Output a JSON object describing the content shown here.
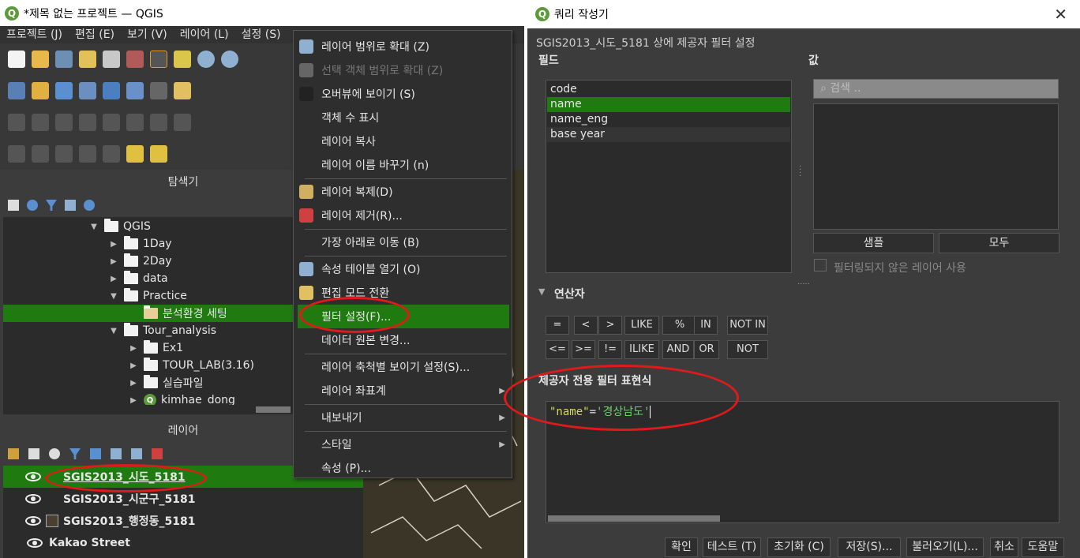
{
  "qgis": {
    "title": "*제목 없는 프로젝트 — QGIS",
    "menu": [
      "프로젝트 (J)",
      "편집 (E)",
      "보기 (V)",
      "레이어 (L)",
      "설정 (S)"
    ],
    "browser_title": "탐색기",
    "browser_items": [
      {
        "label": "QGIS",
        "depth": 0,
        "arrow": "▼",
        "icon": "folder-icon"
      },
      {
        "label": "1Day",
        "depth": 1,
        "arrow": "▶",
        "icon": "folder-icon"
      },
      {
        "label": "2Day",
        "depth": 1,
        "arrow": "▶",
        "icon": "folder-icon"
      },
      {
        "label": "data",
        "depth": 1,
        "arrow": "▶",
        "icon": "folder-icon"
      },
      {
        "label": "Practice",
        "depth": 1,
        "arrow": "▼",
        "icon": "folder-icon"
      },
      {
        "label": "분석환경 세팅",
        "depth": 2,
        "arrow": "",
        "icon": "folder-icon"
      },
      {
        "label": "Tour_analysis",
        "depth": 1,
        "arrow": "▼",
        "icon": "folder-icon"
      },
      {
        "label": "Ex1",
        "depth": 2,
        "arrow": "▶",
        "icon": "folder-icon"
      },
      {
        "label": "TOUR_LAB(3.16)",
        "depth": 2,
        "arrow": "▶",
        "icon": "folder-icon"
      },
      {
        "label": "실습파일",
        "depth": 2,
        "arrow": "▶",
        "icon": "folder-icon"
      },
      {
        "label": "kimhae_dong",
        "depth": 2,
        "arrow": "▶",
        "icon": "qgis-icon"
      }
    ],
    "layers_title": "레이어",
    "layers": [
      {
        "label": "SGIS2013_시도_5181",
        "selected": true
      },
      {
        "label": "SGIS2013_시군구_5181",
        "selected": false
      },
      {
        "label": "SGIS2013_행정동_5181",
        "selected": false
      },
      {
        "label": "Kakao Street",
        "selected": false
      }
    ]
  },
  "context_menu": {
    "items": [
      {
        "label": "레이어 범위로 확대 (Z)",
        "icon": "zoom-layer-icon"
      },
      {
        "label": "선택 객체 범위로 확대 (Z)",
        "icon": "zoom-selection-icon",
        "disabled": true
      },
      {
        "label": "오버뷰에 보이기 (S)",
        "icon": "overview-icon"
      },
      {
        "label": "객체 수 표시"
      },
      {
        "label": "레이어 복사"
      },
      {
        "label": "레이어 이름 바꾸기 (n)"
      },
      {
        "sep": true
      },
      {
        "label": "레이어 복제(D)",
        "icon": "duplicate-icon"
      },
      {
        "label": "레이어 제거(R)...",
        "icon": "remove-icon"
      },
      {
        "sep": true
      },
      {
        "label": "가장 아래로 이동 (B)"
      },
      {
        "sep": true
      },
      {
        "label": "속성 테이블 열기 (O)",
        "icon": "table-icon"
      },
      {
        "label": "편집 모드 전환",
        "icon": "pencil-icon"
      },
      {
        "label": "필터 설정(F)...",
        "selected": true
      },
      {
        "label": "데이터 원본 변경..."
      },
      {
        "sep": true
      },
      {
        "label": "레이어 축척별 보이기 설정(S)..."
      },
      {
        "label": "레이어 좌표계",
        "submenu": true
      },
      {
        "sep": true
      },
      {
        "label": "내보내기",
        "submenu": true
      },
      {
        "sep": true
      },
      {
        "label": "스타일",
        "submenu": true
      },
      {
        "label": "속성 (P)..."
      }
    ]
  },
  "query": {
    "title": "쿼리 작성기",
    "subtitle": "SGIS2013_시도_5181 상에 제공자 필터 설정",
    "fields_label": "필드",
    "fields": [
      "code",
      "name",
      "name_eng",
      "base year"
    ],
    "selected_field": 1,
    "values_label": "값",
    "search_placeholder": "검색 ..",
    "sample_btn": "샘플",
    "all_btn": "모두",
    "unfiltered_label": "필터링되지 않은 레이어 사용",
    "operators_label": "연산자",
    "ops_row1": [
      "=",
      "<",
      ">",
      "LIKE",
      "%",
      "IN",
      "NOT IN"
    ],
    "ops_row2": [
      "<=",
      ">=",
      "!=",
      "ILIKE",
      "AND",
      "OR",
      "NOT"
    ],
    "expr_label": "제공자 전용 필터 표현식",
    "expr_field": "\"name\"",
    "expr_eq": "=",
    "expr_value": "'경상남도'",
    "buttons": [
      "확인",
      "테스트 (T)",
      "초기화 (C)",
      "저장(S)...",
      "불러오기(L)...",
      "취소",
      "도움말"
    ]
  },
  "colors": {
    "highlight": "#1f7a0f",
    "annotation": "#e01a1a"
  }
}
